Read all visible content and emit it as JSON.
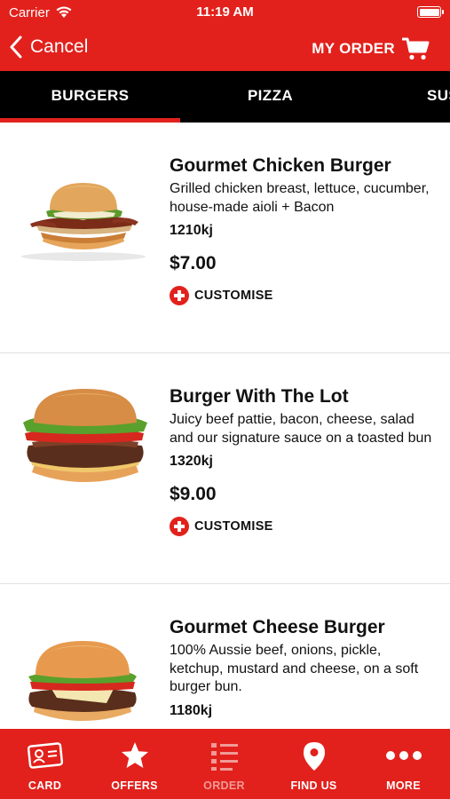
{
  "status_bar": {
    "carrier": "Carrier",
    "time": "11:19 AM"
  },
  "nav": {
    "cancel_label": "Cancel",
    "my_order_label": "MY ORDER"
  },
  "tabs": [
    {
      "label": "BURGERS",
      "selected": true
    },
    {
      "label": "PIZZA",
      "selected": false
    },
    {
      "label": "SUSHI",
      "selected": false
    }
  ],
  "products": [
    {
      "name": "Gourmet Chicken Burger",
      "description": "Grilled chicken breast, lettuce, cucumber, house-made aioli + Bacon",
      "energy": "1210kj",
      "price": "$7.00",
      "customise_label": "CUSTOMISE"
    },
    {
      "name": "Burger With The Lot",
      "description": "Juicy beef pattie, bacon, cheese, salad and our signature sauce on a toasted bun",
      "energy": "1320kj",
      "price": "$9.00",
      "customise_label": "CUSTOMISE"
    },
    {
      "name": "Gourmet Cheese Burger",
      "description": "100% Aussie beef, onions, pickle, ketchup, mustard and cheese, on a soft burger bun.",
      "energy": "1180kj",
      "price": "",
      "customise_label": ""
    }
  ],
  "bottom_tabs": [
    {
      "label": "CARD",
      "icon": "card-icon"
    },
    {
      "label": "OFFERS",
      "icon": "star-icon"
    },
    {
      "label": "ORDER",
      "icon": "order-list-icon",
      "dimmed": true
    },
    {
      "label": "FIND US",
      "icon": "location-pin-icon"
    },
    {
      "label": "MORE",
      "icon": "more-dots-icon"
    }
  ],
  "colors": {
    "brand_red": "#e2211c",
    "tab_bar_black": "#000000",
    "text": "#111111"
  }
}
